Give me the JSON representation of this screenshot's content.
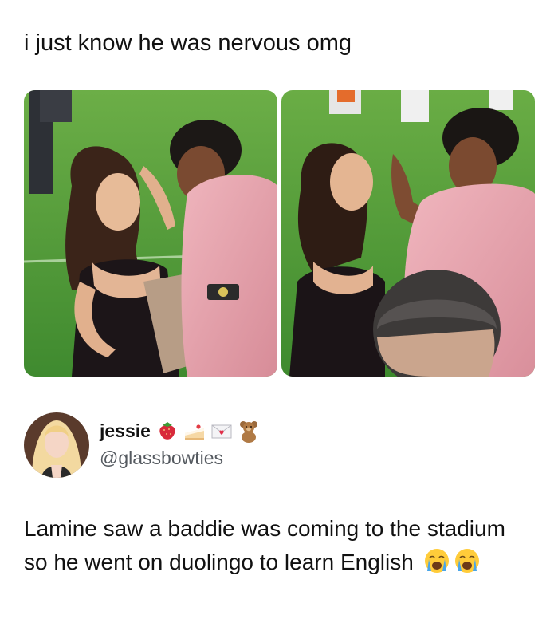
{
  "post": {
    "caption": "i just know he was nervous omg"
  },
  "photos": [
    {
      "name": "photo-left"
    },
    {
      "name": "photo-right"
    }
  ],
  "tweet": {
    "display_name": "jessie",
    "name_emojis": [
      "strawberry-icon",
      "cake-icon",
      "love-letter-icon",
      "teddy-bear-icon"
    ],
    "handle": "@glassbowties",
    "text": "Lamine saw a baddie was coming to the stadium so he went on duolingo to learn English",
    "text_emojis": [
      "crying-face-icon",
      "crying-face-icon"
    ]
  },
  "colors": {
    "pitch_green": "#4f9a3a",
    "hoodie_pink": "#e7a4ad",
    "text": "#111111",
    "handle": "#555a60"
  }
}
